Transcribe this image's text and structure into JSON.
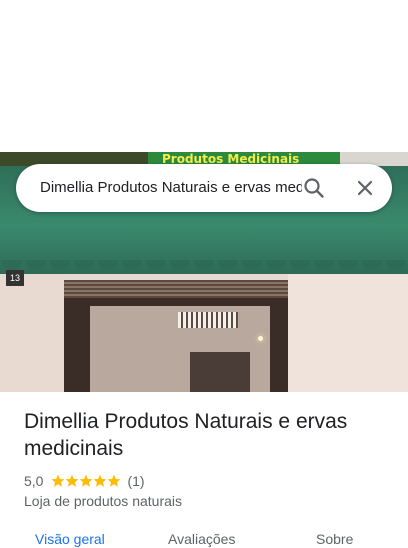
{
  "search": {
    "query": "Dimellia Produtos Naturais e ervas medicinais"
  },
  "photo": {
    "sign_text": "Produtos Medicinais",
    "wall_number": "13"
  },
  "place": {
    "name": "Dimellia Produtos Naturais e ervas medicinais",
    "rating": "5,0",
    "rating_fraction": 1.0,
    "review_count": "(1)",
    "category": "Loja de produtos naturais"
  },
  "tabs": [
    {
      "label": "Visão geral",
      "active": true
    },
    {
      "label": "Avaliações",
      "active": false
    },
    {
      "label": "Sobre",
      "active": false
    }
  ],
  "colors": {
    "accent": "#1a73e8",
    "star": "#fbbc04",
    "text_primary": "#202124",
    "text_secondary": "#5f6368"
  },
  "icons": {
    "search": "search-icon",
    "close": "close-icon",
    "star": "star-icon"
  }
}
